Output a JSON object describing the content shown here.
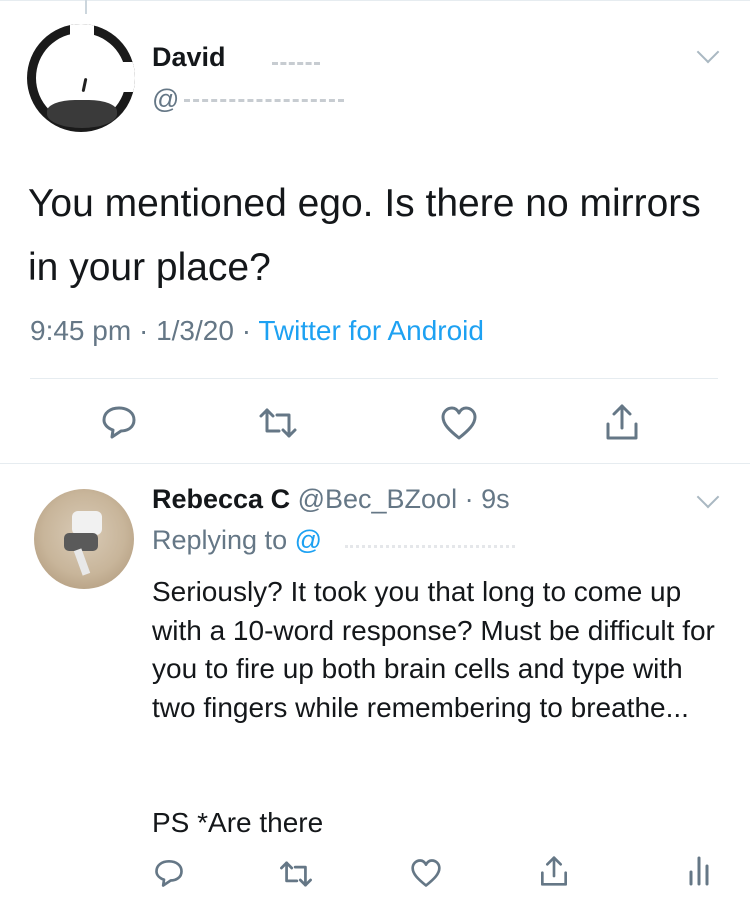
{
  "tweet": {
    "display_name": "David",
    "handle": "@",
    "text": "You mentioned ego. Is there no mirrors in your place?",
    "time": "9:45 pm",
    "sep1": "·",
    "date": "1/3/20",
    "sep2": "·",
    "source": "Twitter for Android"
  },
  "reply": {
    "display_name": "Rebecca C",
    "handle": "@Bec_BZool",
    "sep": "·",
    "time": "9s",
    "replying_prefix": "Replying to",
    "replying_handle": "@",
    "text": "Seriously? It took you that long to come up with a 10-word response? Must be difficult for you to fire up both brain cells and type with two fingers while remembering to breathe...",
    "ps": "PS *Are there"
  },
  "icons": {
    "reply": "reply-icon",
    "retweet": "retweet-icon",
    "like": "heart-icon",
    "share": "share-icon",
    "analytics": "analytics-icon",
    "menu": "chevron-down-icon"
  },
  "colors": {
    "text": "#14171a",
    "secondary": "#657786",
    "link": "#1da1f2",
    "divider": "#e6ecf0",
    "icon": "#657786"
  }
}
